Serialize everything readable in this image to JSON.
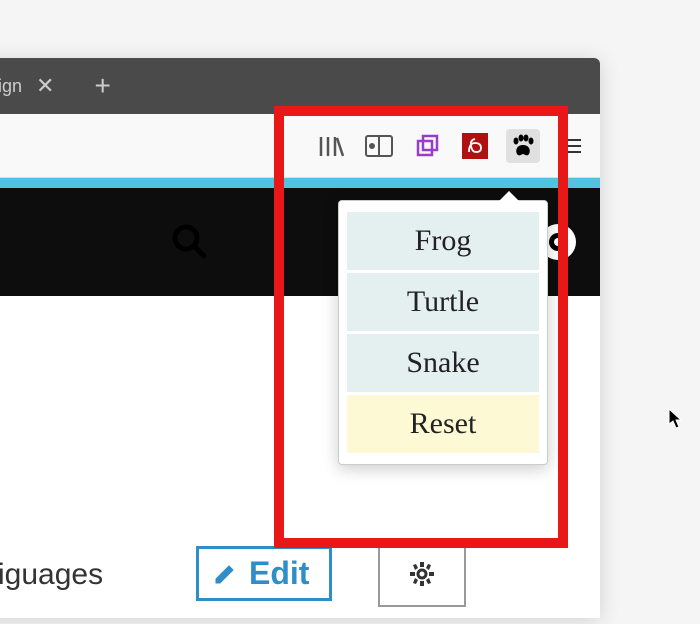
{
  "tab": {
    "label": "Design",
    "close": "✕"
  },
  "toolbar": {
    "library_icon": "library",
    "reader_icon": "reader",
    "copy_icon": "copy",
    "pdf_icon": "pdf",
    "paw_icon": "paw",
    "menu_icon": "menu"
  },
  "popup": {
    "items": [
      {
        "label": "Frog",
        "type": "animal"
      },
      {
        "label": "Turtle",
        "type": "animal"
      },
      {
        "label": "Snake",
        "type": "animal"
      },
      {
        "label": "Reset",
        "type": "reset"
      }
    ]
  },
  "page": {
    "bottom_text": "iguages",
    "edit_label": "Edit"
  }
}
